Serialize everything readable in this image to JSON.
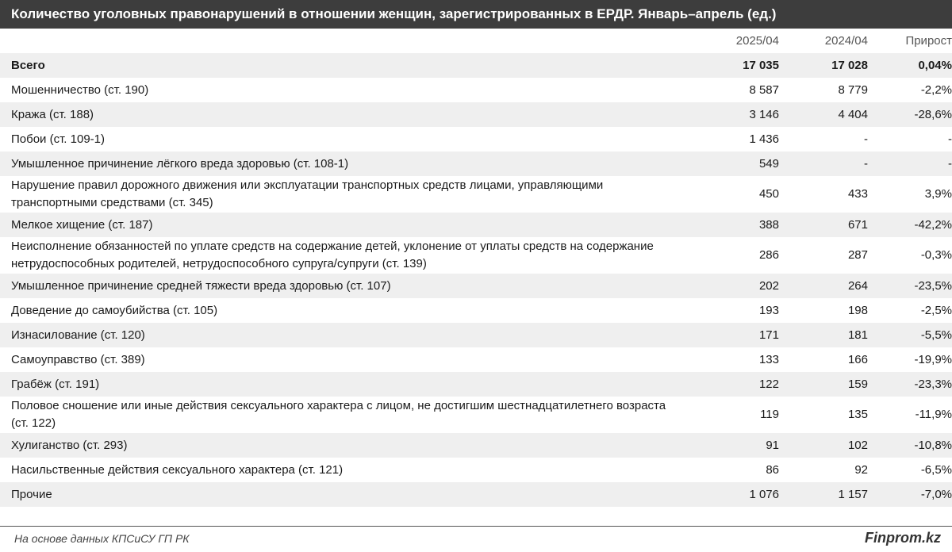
{
  "title": "Количество уголовных правонарушений в отношении женщин, зарегистрированных в ЕРДР. Январь–апрель (ед.)",
  "source": "На основе данных КПСиСУ ГП РК",
  "brand": "Finprom.kz",
  "chart_data": {
    "type": "table",
    "title": "Количество уголовных правонарушений в отношении женщин, зарегистрированных в ЕРДР. Январь–апрель (ед.)",
    "columns": [
      "",
      "2025/04",
      "2024/04",
      "Прирост"
    ],
    "rows": [
      {
        "label": "Всего",
        "v2025": "17 035",
        "v2024": "17 028",
        "growth": "0,04%"
      },
      {
        "label": "Мошенничество (ст. 190)",
        "v2025": "8 587",
        "v2024": "8 779",
        "growth": "-2,2%"
      },
      {
        "label": "Кража (ст. 188)",
        "v2025": "3 146",
        "v2024": "4 404",
        "growth": "-28,6%"
      },
      {
        "label": "Побои (ст. 109-1)",
        "v2025": "1 436",
        "v2024": "-",
        "growth": "-"
      },
      {
        "label": "Умышленное причинение лёгкого вреда здоровью (ст. 108-1)",
        "v2025": "549",
        "v2024": "-",
        "growth": "-"
      },
      {
        "label": "Нарушение правил дорожного движения или эксплуатации транспортных средств лицами, управляющими транспортными средствами (ст. 345)",
        "v2025": "450",
        "v2024": "433",
        "growth": "3,9%"
      },
      {
        "label": "Мелкое хищение (ст. 187)",
        "v2025": "388",
        "v2024": "671",
        "growth": "-42,2%"
      },
      {
        "label": "Неисполнение обязанностей по уплате средств на содержание детей, уклонение от уплаты средств на содержание нетрудоспособных родителей, нетрудоспособного супруга/супруги (ст. 139)",
        "v2025": "286",
        "v2024": "287",
        "growth": "-0,3%"
      },
      {
        "label": "Умышленное причинение средней тяжести вреда здоровью (ст. 107)",
        "v2025": "202",
        "v2024": "264",
        "growth": "-23,5%"
      },
      {
        "label": "Доведение до самоубийства (ст. 105)",
        "v2025": "193",
        "v2024": "198",
        "growth": "-2,5%"
      },
      {
        "label": "Изнасилование (ст. 120)",
        "v2025": "171",
        "v2024": "181",
        "growth": "-5,5%"
      },
      {
        "label": "Самоуправство (ст. 389)",
        "v2025": "133",
        "v2024": "166",
        "growth": "-19,9%"
      },
      {
        "label": "Грабёж (ст. 191)",
        "v2025": "122",
        "v2024": "159",
        "growth": "-23,3%"
      },
      {
        "label": "Половое сношение или иные действия сексуального характера с лицом, не достигшим шестнадцатилетнего возраста (ст. 122)",
        "v2025": "119",
        "v2024": "135",
        "growth": "-11,9%"
      },
      {
        "label": "Хулиганство (ст. 293)",
        "v2025": "91",
        "v2024": "102",
        "growth": "-10,8%"
      },
      {
        "label": "Насильственные действия сексуального характера (ст. 121)",
        "v2025": "86",
        "v2024": "92",
        "growth": "-6,5%"
      },
      {
        "label": "Прочие",
        "v2025": "1 076",
        "v2024": "1 157",
        "growth": "-7,0%"
      }
    ],
    "colors": {
      "title_bg": "#3d3d3d",
      "shade": "#efefef",
      "text": "#1a1a1a"
    }
  }
}
